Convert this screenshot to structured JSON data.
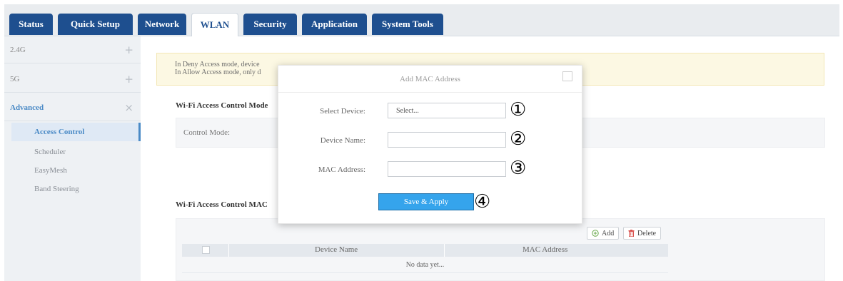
{
  "nav": {
    "tabs": [
      {
        "label": "Status"
      },
      {
        "label": "Quick Setup"
      },
      {
        "label": "Network"
      },
      {
        "label": "WLAN"
      },
      {
        "label": "Security"
      },
      {
        "label": "Application"
      },
      {
        "label": "System Tools"
      }
    ],
    "active_tab": "WLAN"
  },
  "sidebar": {
    "groups": [
      {
        "label": "2.4G",
        "sign": "+"
      },
      {
        "label": "5G",
        "sign": "+"
      },
      {
        "label": "Advanced",
        "sign": "×"
      }
    ],
    "items": [
      {
        "label": "Access Control",
        "active": true
      },
      {
        "label": "Scheduler"
      },
      {
        "label": "EasyMesh"
      },
      {
        "label": "Band Steering"
      }
    ]
  },
  "main": {
    "notice_line1": "In Deny Access mode, device",
    "notice_line2": "In Allow Access mode, only d",
    "mode_section_title": "Wi-Fi Access Control Mode",
    "control_mode_label": "Control Mode:",
    "mac_section_title": "Wi-Fi Access Control MAC",
    "add_label": "Add",
    "delete_label": "Delete",
    "table_headers": [
      "Device Name",
      "MAC Address"
    ],
    "empty_text": "No data yet..."
  },
  "modal": {
    "title": "Add MAC Address",
    "select_device_label": "Select Device:",
    "select_device_value": "Select...",
    "device_name_label": "Device Name:",
    "device_name_value": "",
    "mac_address_label": "MAC Address:",
    "mac_address_value": "",
    "save_label": "Save & Apply",
    "callouts": [
      "①",
      "②",
      "③",
      "④"
    ]
  },
  "colors": {
    "tab_bg": "#1e4f8f",
    "accent": "#4a8ac6",
    "save_button": "#35a4ec",
    "notice_bg": "#fcf8e3"
  },
  "icons": {
    "add": "plus-circle-icon",
    "delete": "trash-icon",
    "expand": "plus-icon",
    "collapse": "close-icon"
  }
}
